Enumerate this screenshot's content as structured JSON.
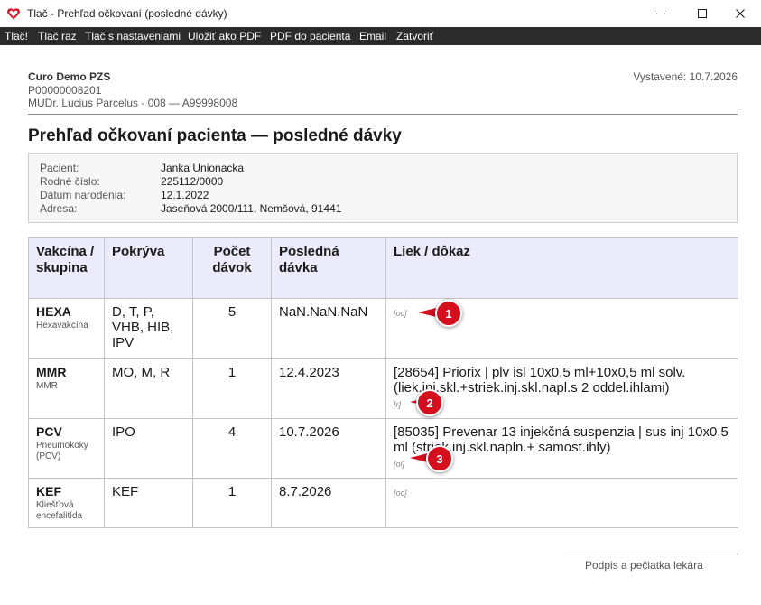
{
  "window": {
    "title": "Tlač - Prehľad očkovaní (posledné dávky)"
  },
  "menu": {
    "items": [
      "Tlač!",
      "Tlač raz",
      "Tlač s nastaveniami",
      "Uložiť ako PDF",
      "PDF do pacienta",
      "Email",
      "Zatvoriť"
    ]
  },
  "header": {
    "org_name": "Curo Demo PZS",
    "org_id": "P00000008201",
    "doctor": "MUDr. Lucius Parcelus - 008 — A99998008",
    "issued_label": "Vystavené:",
    "issued_date": "10.7.2026"
  },
  "document": {
    "title": "Prehľad očkovaní pacienta — posledné dávky"
  },
  "patient": {
    "name_label": "Pacient:",
    "name": "Janka Unionacka",
    "birth_no_label": "Rodné číslo:",
    "birth_no": "225112/0000",
    "dob_label": "Dátum narodenia:",
    "dob": "12.1.2022",
    "address_label": "Adresa:",
    "address": "Jaseňová 2000/111, Nemšová, 91441"
  },
  "table": {
    "headers": {
      "vaccine": "Vakcína / skupina",
      "coverage": "Pokrýva",
      "doses": "Počet dávok",
      "last_dose": "Posledná dávka",
      "drug": "Liek / dôkaz"
    },
    "rows": [
      {
        "code": "HEXA",
        "name": "Hexavakcína",
        "coverage": "D, T, P, VHB, HIB, IPV",
        "doses": "5",
        "last": "NaN.NaN.NaN",
        "drug": "",
        "proof": "[oc]"
      },
      {
        "code": "MMR",
        "name": "MMR",
        "coverage": "MO, M, R",
        "doses": "1",
        "last": "12.4.2023",
        "drug": "[28654] Priorix | plv isl 10x0,5 ml+10x0,5 ml solv. (liek.inj.skl.+striek.inj.skl.napl.s 2 oddel.ihlami)",
        "proof": "[r]"
      },
      {
        "code": "PCV",
        "name": "Pneumokoky (PCV)",
        "coverage": "IPO",
        "doses": "4",
        "last": "10.7.2026",
        "drug": "[85035] Prevenar 13 injekčná suspenzia | sus inj 10x0,5 ml (striek.inj.skl.napln.+ samost.ihly)",
        "proof": "[ol]"
      },
      {
        "code": "KEF",
        "name": "Kliešťová encefalitída",
        "coverage": "KEF",
        "doses": "1",
        "last": "8.7.2026",
        "drug": "",
        "proof": "[oc]"
      }
    ]
  },
  "callouts": [
    "1",
    "2",
    "3"
  ],
  "footer": {
    "signature": "Podpis a pečiatka lekára"
  },
  "colors": {
    "menubar": "#2b2b2b",
    "table_header": "#ecebfb",
    "callout": "#d60f1e"
  }
}
